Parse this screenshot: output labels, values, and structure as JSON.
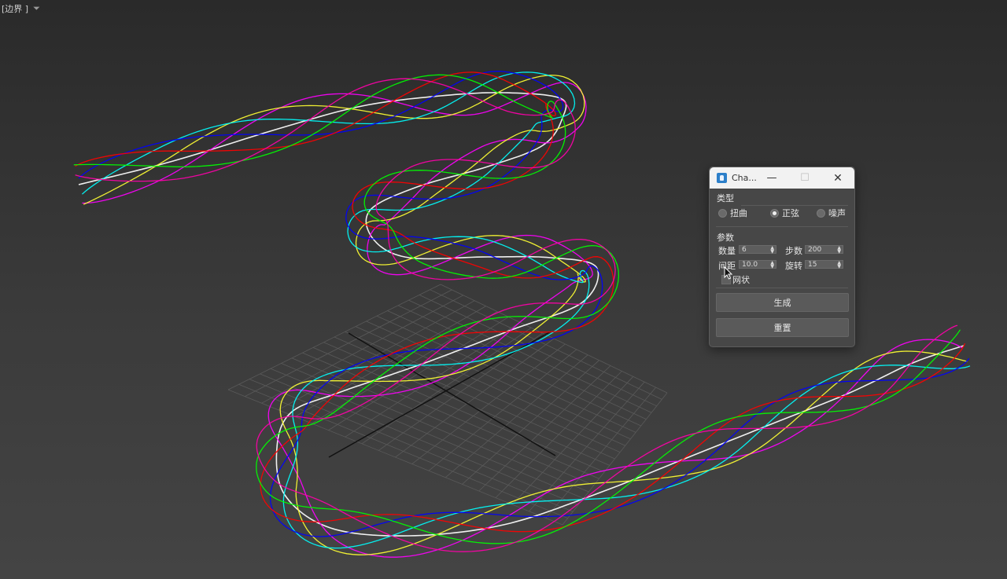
{
  "viewport": {
    "label": "[边界 ]",
    "filter_icon": "filter-icon",
    "grid_color": "#5a5a5a",
    "axis_color": "#111111",
    "curve_colors": [
      "#ffffff",
      "#ff00ff",
      "#ffff33",
      "#00ffff",
      "#0000ff",
      "#ff0000",
      "#00ff00",
      "#ff00aa"
    ]
  },
  "dialog": {
    "title": "Cha...",
    "app_icon": "app-icon",
    "type_section": {
      "label": "类型",
      "options": [
        {
          "label": "扭曲",
          "selected": false
        },
        {
          "label": "正弦",
          "selected": true
        },
        {
          "label": "噪声",
          "selected": false
        }
      ]
    },
    "params_section": {
      "label": "参数",
      "quantity_label": "数量",
      "quantity_value": "6",
      "steps_label": "步数",
      "steps_value": "200",
      "spacing_label": "间距",
      "spacing_value": "10.0",
      "rotation_label": "旋转",
      "rotation_value": "15",
      "mesh_label": "网状",
      "mesh_checked": false
    },
    "generate_label": "生成",
    "reset_label": "重置"
  }
}
